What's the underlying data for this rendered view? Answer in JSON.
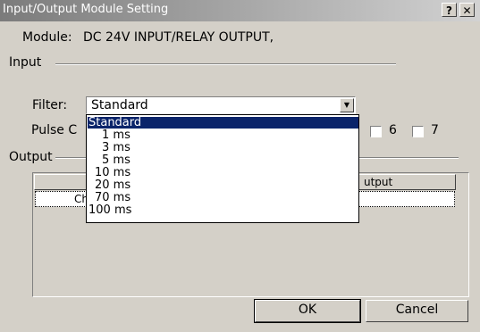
{
  "window": {
    "title": "Input/Output Module Setting",
    "help_btn": "?",
    "close_btn": "✕"
  },
  "module": {
    "label": "Module:",
    "value": "DC 24V INPUT/RELAY OUTPUT,"
  },
  "input": {
    "group_label": "Input",
    "filter": {
      "label": "Filter:",
      "value": "Standard",
      "options": [
        "Standard",
        "1 ms",
        "3 ms",
        "5 ms",
        "10 ms",
        "20 ms",
        "70 ms",
        "100 ms"
      ]
    },
    "pulse": {
      "label_visible": "Pulse C",
      "channels_visible": [
        "6",
        "7"
      ]
    }
  },
  "output": {
    "group_label": "Output",
    "columns_visible": [
      "utput"
    ],
    "rows": [
      {
        "col1": "Ch"
      }
    ]
  },
  "buttons": {
    "ok": "OK",
    "cancel": "Cancel"
  }
}
